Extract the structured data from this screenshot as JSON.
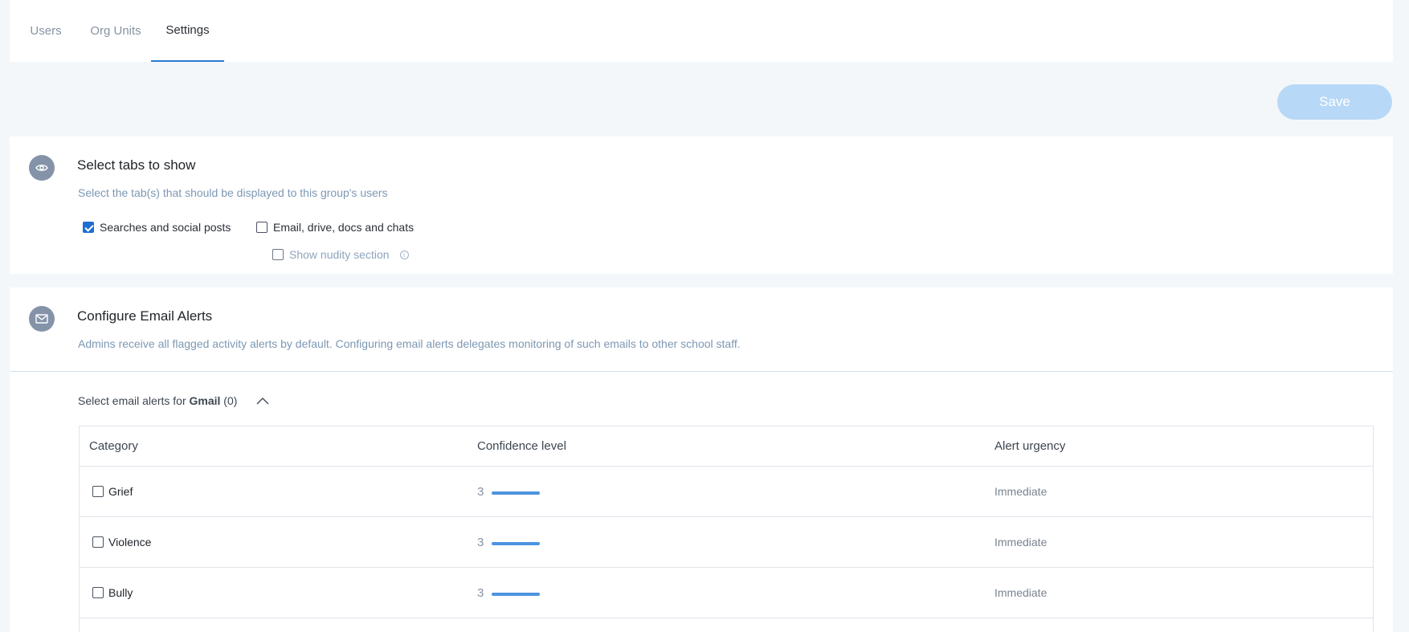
{
  "tabs": [
    {
      "label": "Users",
      "active": false
    },
    {
      "label": "Org Units",
      "active": false
    },
    {
      "label": "Settings",
      "active": true
    }
  ],
  "save_label": "Save",
  "tabs_section": {
    "title": "Select tabs to show",
    "description": "Select the tab(s) that should be displayed to this group's users",
    "icon": "eye-icon",
    "options": [
      {
        "label": "Searches and social posts",
        "checked": true
      },
      {
        "label": "Email, drive, docs and chats",
        "checked": false
      },
      {
        "label": "Show nudity section",
        "checked": false
      }
    ]
  },
  "email_alerts": {
    "title": "Configure Email Alerts",
    "description": "Admins receive all flagged activity alerts by default. Configuring email alerts delegates monitoring of such emails to other school staff.",
    "icon": "mail-icon",
    "toggle_prefix": "Select email alerts for ",
    "toggle_service": "Gmail",
    "toggle_count": " (0)",
    "columns": [
      "Category",
      "Confidence level",
      "Alert urgency"
    ],
    "rows": [
      {
        "category": "Grief",
        "confidence": "3",
        "urgency": "Immediate",
        "checked": false
      },
      {
        "category": "Violence",
        "confidence": "3",
        "urgency": "Immediate",
        "checked": false
      },
      {
        "category": "Bully",
        "confidence": "3",
        "urgency": "Immediate",
        "checked": false
      }
    ]
  },
  "colors": {
    "accent": "#2a7bd3",
    "save_disabled": "#b8d8f7",
    "icon_bg": "#8593a9",
    "bar_fill": "#4c93e0"
  }
}
